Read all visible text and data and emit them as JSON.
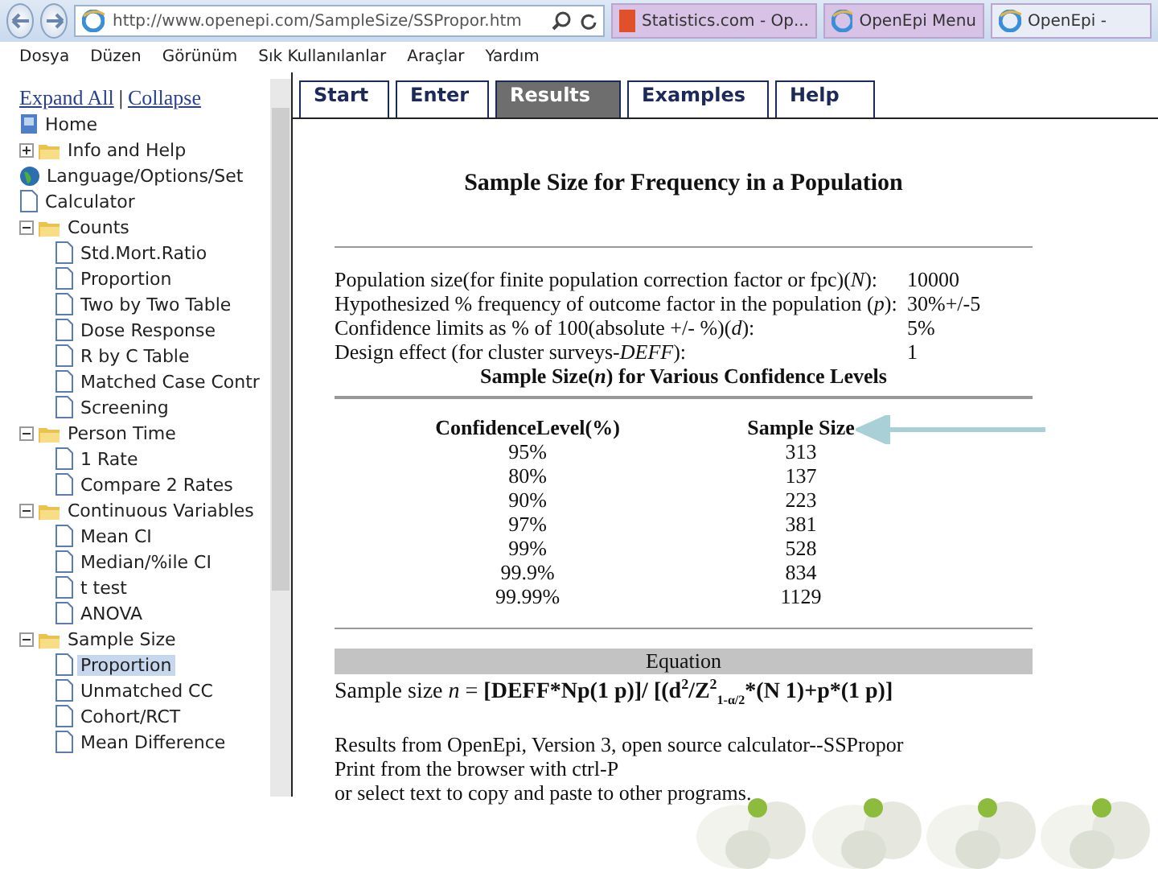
{
  "browser": {
    "address": "http://www.openepi.com/SampleSize/SSPropor.htm",
    "tabs": [
      {
        "label": "Statistics.com - Op...",
        "kind": "site",
        "selected": false
      },
      {
        "label": "OpenEpi Menu",
        "kind": "ie",
        "selected": false
      },
      {
        "label": "OpenEpi -",
        "kind": "ie",
        "selected": true
      }
    ],
    "menu": [
      "Dosya",
      "Düzen",
      "Görünüm",
      "Sık Kullanılanlar",
      "Araçlar",
      "Yardım"
    ]
  },
  "sidebar": {
    "expand_all": "Expand All",
    "separator": "|",
    "collapse": "Collapse",
    "tree": [
      {
        "label": "Home",
        "kind": "home",
        "selected": false
      },
      {
        "label": "Info and Help",
        "kind": "folder",
        "expanded": false,
        "selected": false
      },
      {
        "label": "Language/Options/Set",
        "kind": "globe",
        "selected": false
      },
      {
        "label": "Calculator",
        "kind": "page",
        "selected": false
      },
      {
        "label": "Counts",
        "kind": "folder",
        "expanded": true,
        "selected": false,
        "children": [
          {
            "label": "Std.Mort.Ratio",
            "kind": "page",
            "selected": false
          },
          {
            "label": "Proportion",
            "kind": "page",
            "selected": false
          },
          {
            "label": "Two by Two Table",
            "kind": "page",
            "selected": false
          },
          {
            "label": "Dose Response",
            "kind": "page",
            "selected": false
          },
          {
            "label": "R by C Table",
            "kind": "page",
            "selected": false
          },
          {
            "label": "Matched Case Contr",
            "kind": "page",
            "selected": false
          },
          {
            "label": "Screening",
            "kind": "page",
            "selected": false
          }
        ]
      },
      {
        "label": "Person Time",
        "kind": "folder",
        "expanded": true,
        "selected": false,
        "children": [
          {
            "label": "1 Rate",
            "kind": "page",
            "selected": false
          },
          {
            "label": "Compare 2 Rates",
            "kind": "page",
            "selected": false
          }
        ]
      },
      {
        "label": "Continuous Variables",
        "kind": "folder",
        "expanded": true,
        "selected": false,
        "children": [
          {
            "label": "Mean CI",
            "kind": "page",
            "selected": false
          },
          {
            "label": "Median/%ile CI",
            "kind": "page",
            "selected": false
          },
          {
            "label": "t test",
            "kind": "page",
            "selected": false
          },
          {
            "label": "ANOVA",
            "kind": "page",
            "selected": false
          }
        ]
      },
      {
        "label": "Sample Size",
        "kind": "folder",
        "expanded": true,
        "selected": false,
        "children": [
          {
            "label": "Proportion",
            "kind": "page",
            "selected": true
          },
          {
            "label": "Unmatched CC",
            "kind": "page",
            "selected": false
          },
          {
            "label": "Cohort/RCT",
            "kind": "page",
            "selected": false
          },
          {
            "label": "Mean Difference",
            "kind": "page",
            "selected": false
          }
        ]
      }
    ]
  },
  "tabs": [
    {
      "label": "Start",
      "selected": false
    },
    {
      "label": "Enter",
      "selected": false
    },
    {
      "label": "Results",
      "selected": true
    },
    {
      "label": "Examples",
      "selected": false
    },
    {
      "label": "Help",
      "selected": false
    }
  ],
  "results": {
    "title": "Sample Size for Frequency in a Population",
    "parameters": [
      {
        "label": "Population size(for finite population correction factor or fpc)(*N*):",
        "value": "10000"
      },
      {
        "label": "Hypothesized % frequency of outcome factor in the population (*p*):",
        "value": "30%+/-5"
      },
      {
        "label": "Confidence limits as % of 100(absolute +/- %)(*d*):",
        "value": "5%"
      },
      {
        "label": "Design effect (for cluster surveys-*DEFF*):",
        "value": "1"
      }
    ],
    "table_title": "Sample Size(*n*) for Various Confidence Levels",
    "columns": [
      "ConfidenceLevel(%)",
      "Sample Size"
    ],
    "rows": [
      [
        "95%",
        "313"
      ],
      [
        "80%",
        "137"
      ],
      [
        "90%",
        "223"
      ],
      [
        "97%",
        "381"
      ],
      [
        "99%",
        "528"
      ],
      [
        "99.9%",
        "834"
      ],
      [
        "99.99%",
        "1129"
      ]
    ],
    "equation_heading": "Equation",
    "equation": [
      {
        "text": "Sample size ",
        "kind": "plain"
      },
      {
        "text": "n",
        "kind": "italic"
      },
      {
        "text": " = ",
        "kind": "plain"
      },
      {
        "text": "[DEFF*Np(1 p)]/ [(d",
        "kind": "bold"
      },
      {
        "text": "2",
        "kind": "sup"
      },
      {
        "text": "/Z",
        "kind": "bold"
      },
      {
        "text": "2",
        "kind": "sup"
      },
      {
        "text": "1-α/2",
        "kind": "sub"
      },
      {
        "text": "*(N 1)+p*(1 p)]",
        "kind": "bold"
      }
    ],
    "footer": [
      "Results from OpenEpi, Version 3, open source calculator--SSPropor",
      "Print from the browser with ctrl-P",
      "or select text to copy and paste to other programs."
    ]
  }
}
